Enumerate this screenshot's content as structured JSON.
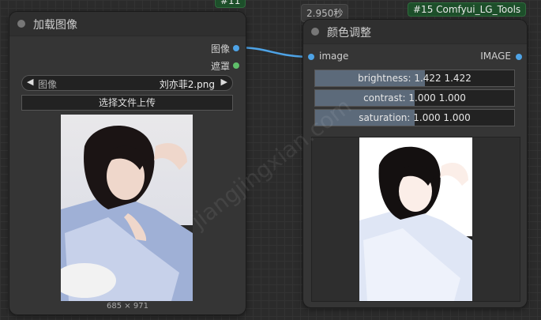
{
  "load_node": {
    "id_badge": "#11",
    "title": "加载图像",
    "outputs": [
      "图像",
      "遮罩"
    ],
    "image_combo": {
      "label": "图像",
      "value": "刘亦菲2.png"
    },
    "upload_button": "选择文件上传",
    "image_size": "685 × 971"
  },
  "color_node": {
    "exec_time": "2.950秒",
    "id_badge": "#15 Comfyui_LG_Tools",
    "title": "颜色调整",
    "input": "image",
    "output": "IMAGE",
    "sliders": [
      {
        "label": "brightness: 1.422  1.422",
        "fraction": 0.55
      },
      {
        "label": "contrast: 1.000  1.000",
        "fraction": 0.5
      },
      {
        "label": "saturation: 1.000  1.000",
        "fraction": 0.5
      }
    ]
  },
  "watermark": "jiangjingxian.com",
  "colors": {
    "badge_green": "#1d4f2a",
    "link_blue": "#4ea3e6",
    "socket_green": "#5fbf6a"
  }
}
